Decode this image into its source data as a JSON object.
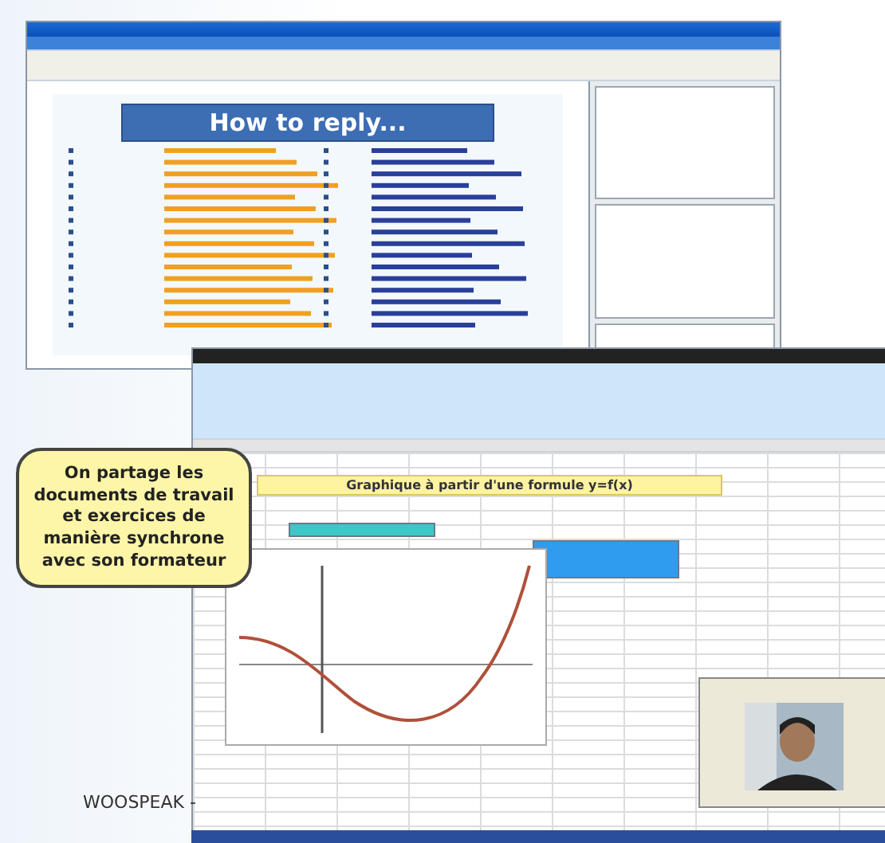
{
  "presentation": {
    "slide_title": "How to reply..."
  },
  "spreadsheet": {
    "banner": "Graphique à partir d'une formule y=f(x)"
  },
  "callout": {
    "text": "On partage les documents de travail et exercices de manière synchrone avec son formateur"
  },
  "footer": {
    "brand": "WOOSPEAK -"
  }
}
